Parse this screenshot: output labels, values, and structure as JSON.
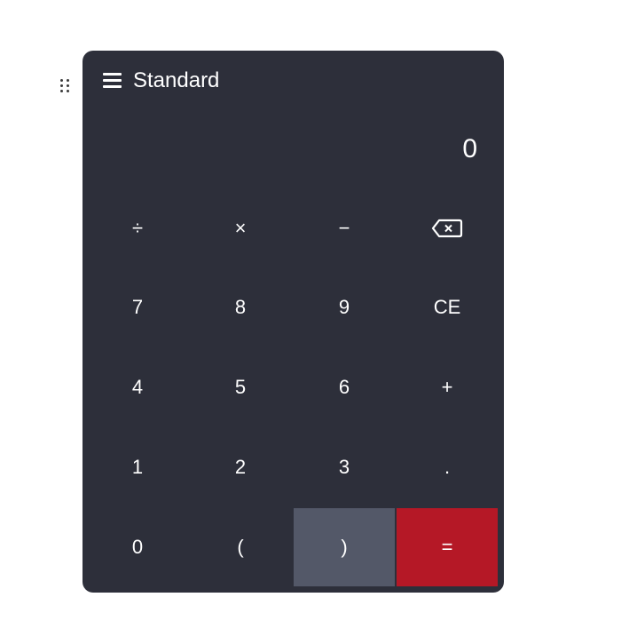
{
  "calculator": {
    "mode_title": "Standard",
    "display_value": "0",
    "colors": {
      "panel_bg": "#2d2f3a",
      "key_text": "#ffffff",
      "pressed_key_bg": "#535868",
      "equals_bg": "#b51826"
    },
    "icons": {
      "menu": "hamburger-menu-icon",
      "drag": "drag-handle-icon",
      "backspace": "backspace-icon"
    },
    "keys": {
      "divide": "÷",
      "multiply": "×",
      "subtract": "−",
      "seven": "7",
      "eight": "8",
      "nine": "9",
      "clear_entry": "CE",
      "four": "4",
      "five": "5",
      "six": "6",
      "add": "+",
      "one": "1",
      "two": "2",
      "three": "3",
      "decimal": ".",
      "zero": "0",
      "open_paren": "(",
      "close_paren": ")",
      "equals": "="
    }
  }
}
